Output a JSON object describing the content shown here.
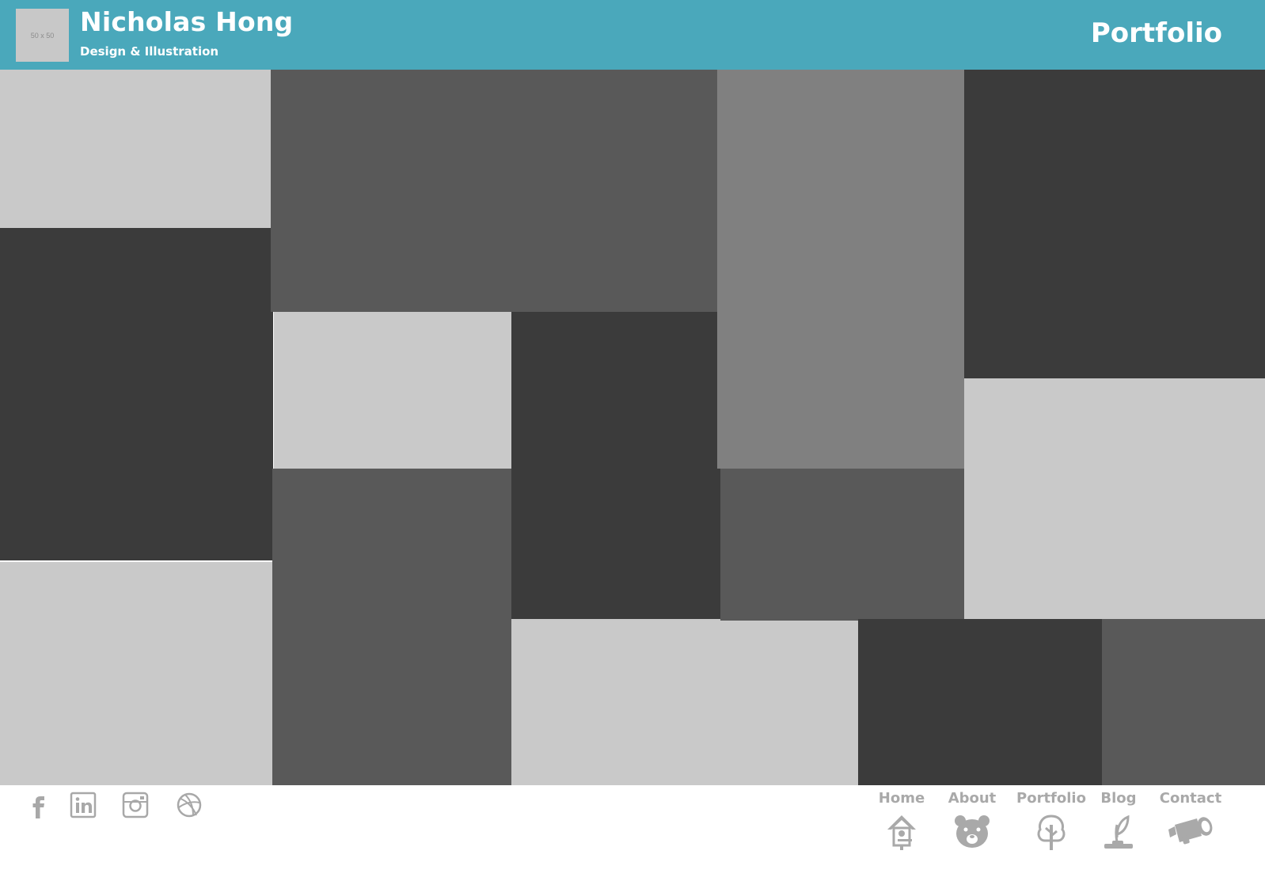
{
  "header": {
    "logo_placeholder": "50 x 50",
    "title": "Nicholas Hong",
    "subtitle": "Design & Illustration",
    "page_heading": "Portfolio"
  },
  "nav": {
    "items": [
      {
        "label": "Home",
        "icon": "birdhouse-icon"
      },
      {
        "label": "About",
        "icon": "bear-icon"
      },
      {
        "label": "Portfolio",
        "icon": "tree-icon"
      },
      {
        "label": "Blog",
        "icon": "sprout-icon"
      },
      {
        "label": "Contact",
        "icon": "binoculars-icon"
      }
    ]
  },
  "social": {
    "items": [
      {
        "icon": "facebook-icon"
      },
      {
        "icon": "linkedin-icon"
      },
      {
        "icon": "instagram-icon"
      },
      {
        "icon": "dribbble-icon"
      }
    ]
  },
  "colors": {
    "header": "#4aa8bb",
    "tile_light": "#c9c9c9",
    "tile_mid": "#595959",
    "tile_gray": "#808080",
    "tile_dark": "#3b3b3b",
    "footer_icon": "#a9a9a9"
  }
}
